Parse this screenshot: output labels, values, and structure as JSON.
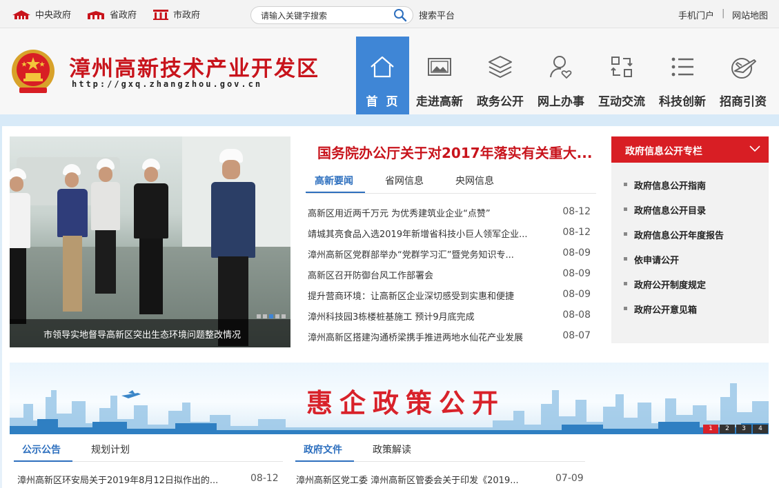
{
  "topbar": {
    "links": [
      "中央政府",
      "省政府",
      "市政府"
    ],
    "search_placeholder": "请输入关键字搜索",
    "search_platform": "搜索平台",
    "mobile_portal": "手机门户",
    "separator": "|",
    "sitemap": "网站地图"
  },
  "header": {
    "title": "漳州高新技术产业开发区",
    "url": "http://gxq.zhangzhou.gov.cn"
  },
  "nav": [
    {
      "label": "首页",
      "icon": "home-icon",
      "active": true
    },
    {
      "label": "走进高新",
      "icon": "image-icon"
    },
    {
      "label": "政务公开",
      "icon": "layers-icon"
    },
    {
      "label": "网上办事",
      "icon": "user-heart-icon"
    },
    {
      "label": "互动交流",
      "icon": "exchange-icon"
    },
    {
      "label": "科技创新",
      "icon": "list-icon"
    },
    {
      "label": "招商引资",
      "icon": "airplane-icon"
    }
  ],
  "slider": {
    "caption": "市领导实地督导高新区突出生态环境问题整改情况"
  },
  "headline": "国务院办公厅关于对2017年落实有关重大...",
  "news_tabs": [
    "高新要闻",
    "省网信息",
    "央网信息"
  ],
  "news": [
    {
      "title": "高新区用近两千万元 为优秀建筑业企业“点赞”",
      "date": "08-12"
    },
    {
      "title": "靖城其亮食品入选2019年新增省科技小巨人领军企业...",
      "date": "08-12"
    },
    {
      "title": "漳州高新区党群部举办“党群学习汇”暨党务知识专...",
      "date": "08-09"
    },
    {
      "title": "高新区召开防御台风工作部署会",
      "date": "08-09"
    },
    {
      "title": "提升营商环境：让高新区企业深切感受到实惠和便捷",
      "date": "08-09"
    },
    {
      "title": "漳州科技园3栋楼桩基施工 预计9月底完成",
      "date": "08-08"
    },
    {
      "title": "漳州高新区搭建沟通桥梁携手推进两地水仙花产业发展",
      "date": "08-07"
    }
  ],
  "gov_info": {
    "title": "政府信息公开专栏",
    "items": [
      "政府信息公开指南",
      "政府信息公开目录",
      "政府信息公开年度报告",
      "依申请公开",
      "政府公开制度规定",
      "政府公开意见箱"
    ]
  },
  "banner": {
    "title": "惠企政策公开",
    "pages": [
      "1",
      "2",
      "3",
      "4"
    ]
  },
  "left_section": {
    "tabs": [
      "公示公告",
      "规划计划"
    ],
    "row": {
      "title": "漳州高新区环安局关于2019年8月12日拟作出的...",
      "date": "08-12"
    }
  },
  "right_section": {
    "tabs": [
      "政府文件",
      "政策解读"
    ],
    "row": {
      "title": "漳州高新区党工委 漳州高新区管委会关于印发《2019...",
      "date": "07-09"
    }
  },
  "colors": {
    "brand_red": "#c8141c",
    "nav_active": "#3f86d6",
    "link_blue": "#2d6fbe",
    "gov_head_red": "#d81e24"
  }
}
